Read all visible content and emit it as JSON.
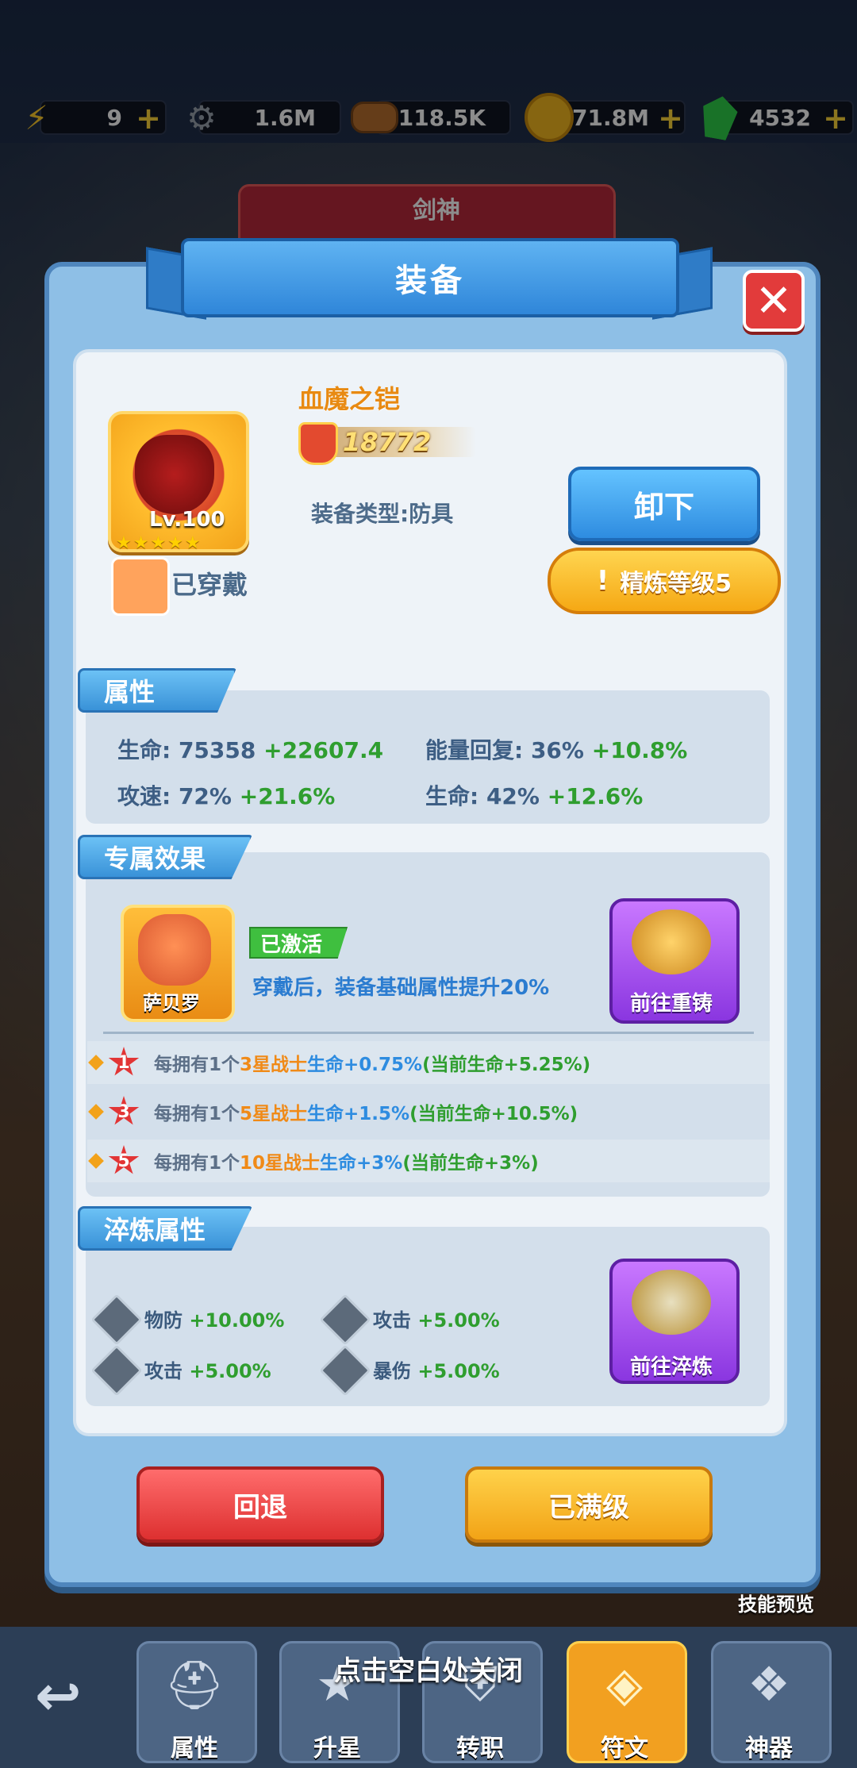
{
  "resources": [
    {
      "name": "energy",
      "value": "9",
      "icon": "lightning-icon",
      "color": "#ffcc2a"
    },
    {
      "name": "gear",
      "value": "1.6M",
      "icon": "gear-icon",
      "color": "#9aa3ad"
    },
    {
      "name": "wood",
      "value": "118.5K",
      "icon": "log-icon",
      "color": "#b8702f"
    },
    {
      "name": "gold",
      "value": "271.8M",
      "icon": "coin-icon",
      "color": "#f5b81f"
    },
    {
      "name": "gem",
      "value": "4532",
      "icon": "gem-icon",
      "color": "#2fd04a"
    }
  ],
  "background": {
    "hero_class": "剑神"
  },
  "modal": {
    "title": "装备",
    "close": "✕"
  },
  "equipment": {
    "name": "血魔之铠",
    "power": "18772",
    "level": "Lv.100",
    "stars": "★★★★★",
    "type_label": "装备类型:防具",
    "worn_label": "已穿戴",
    "unequip_label": "卸下",
    "refine_label": "精炼等级5"
  },
  "attributes": {
    "title": "属性",
    "items": [
      {
        "label": "生命: ",
        "value": "75358",
        "bonus": "+22607.4"
      },
      {
        "label": "能量回复: ",
        "value": "36%",
        "bonus": "+10.8%"
      },
      {
        "label": "攻速: ",
        "value": "72%",
        "bonus": "+21.6%"
      },
      {
        "label": "生命: ",
        "value": "42%",
        "bonus": "+12.6%"
      }
    ]
  },
  "exclusive": {
    "title": "专属效果",
    "hero_name": "萨贝罗",
    "status": "已激活",
    "description": "穿戴后，装备基础属性提升20%",
    "reforge_label": "前往重铸",
    "bonuses": [
      {
        "rank": "1",
        "prefix": "每拥有1个",
        "star": "3星战士",
        "stat": "生命+0.75%",
        "current": "(当前生命+5.25%)"
      },
      {
        "rank": "3",
        "prefix": "每拥有1个",
        "star": "5星战士",
        "stat": "生命+1.5%",
        "current": "(当前生命+10.5%)"
      },
      {
        "rank": "5",
        "prefix": "每拥有1个",
        "star": "10星战士",
        "stat": "生命+3%",
        "current": "(当前生命+3%)"
      }
    ]
  },
  "refine": {
    "title": "淬炼属性",
    "button": "前往淬炼",
    "items": [
      {
        "label": "物防 ",
        "value": "+10.00%"
      },
      {
        "label": "攻击 ",
        "value": "+5.00%"
      },
      {
        "label": "攻击 ",
        "value": "+5.00%"
      },
      {
        "label": "暴伤 ",
        "value": "+5.00%"
      }
    ]
  },
  "buttons": {
    "back": "回退",
    "max": "已满级"
  },
  "close_hint": "点击空白处关闭",
  "skill_preview": "技能预览",
  "nav": [
    {
      "label": "属性",
      "icon": "helmet-icon"
    },
    {
      "label": "升星",
      "icon": "star-icon"
    },
    {
      "label": "转职",
      "icon": "shield-icon"
    },
    {
      "label": "符文",
      "icon": "rune-icon",
      "active": true
    },
    {
      "label": "神器",
      "icon": "wings-icon"
    }
  ]
}
